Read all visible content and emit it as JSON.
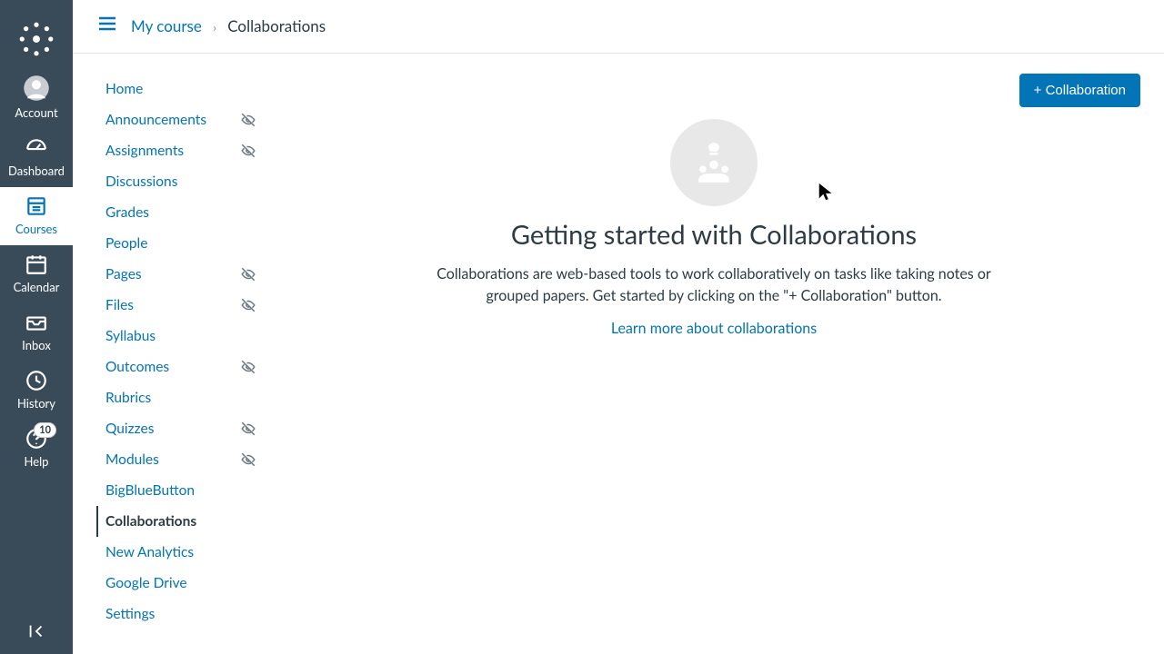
{
  "rail": {
    "items": [
      {
        "key": "account",
        "label": "Account"
      },
      {
        "key": "dashboard",
        "label": "Dashboard"
      },
      {
        "key": "courses",
        "label": "Courses"
      },
      {
        "key": "calendar",
        "label": "Calendar"
      },
      {
        "key": "inbox",
        "label": "Inbox"
      },
      {
        "key": "history",
        "label": "History"
      },
      {
        "key": "help",
        "label": "Help"
      }
    ],
    "help_badge": "10"
  },
  "breadcrumb": {
    "course": "My course",
    "page": "Collaborations"
  },
  "coursenav": [
    {
      "label": "Home",
      "hidden": false,
      "active": false
    },
    {
      "label": "Announcements",
      "hidden": true,
      "active": false
    },
    {
      "label": "Assignments",
      "hidden": true,
      "active": false
    },
    {
      "label": "Discussions",
      "hidden": false,
      "active": false
    },
    {
      "label": "Grades",
      "hidden": false,
      "active": false
    },
    {
      "label": "People",
      "hidden": false,
      "active": false
    },
    {
      "label": "Pages",
      "hidden": true,
      "active": false
    },
    {
      "label": "Files",
      "hidden": true,
      "active": false
    },
    {
      "label": "Syllabus",
      "hidden": false,
      "active": false
    },
    {
      "label": "Outcomes",
      "hidden": true,
      "active": false
    },
    {
      "label": "Rubrics",
      "hidden": false,
      "active": false
    },
    {
      "label": "Quizzes",
      "hidden": true,
      "active": false
    },
    {
      "label": "Modules",
      "hidden": true,
      "active": false
    },
    {
      "label": "BigBlueButton",
      "hidden": false,
      "active": false
    },
    {
      "label": "Collaborations",
      "hidden": false,
      "active": true
    },
    {
      "label": "New Analytics",
      "hidden": false,
      "active": false
    },
    {
      "label": "Google Drive",
      "hidden": false,
      "active": false
    },
    {
      "label": "Settings",
      "hidden": false,
      "active": false
    }
  ],
  "content": {
    "add_button": "+ Collaboration",
    "heading": "Getting started with Collaborations",
    "body": "Collaborations are web-based tools to work collaboratively on tasks like taking notes or grouped papers. Get started by clicking on the \"+ Collaboration\" button.",
    "learn_more": "Learn more about collaborations"
  }
}
